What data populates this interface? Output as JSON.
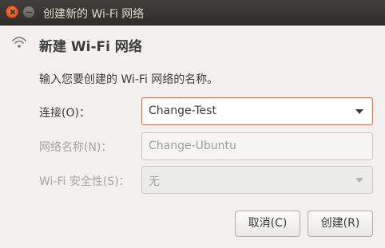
{
  "window": {
    "title": "创建新的 Wi-Fi 网络"
  },
  "header": {
    "icon": "wifi-icon",
    "title": "新建 Wi-Fi 网络"
  },
  "description": "输入您要创建的 Wi-Fi 网络的名称。",
  "form": {
    "connection": {
      "label": "连接(O)：",
      "value": "Change-Test"
    },
    "network_name": {
      "label": "网络名称(N)：",
      "value": "Change-Ubuntu"
    },
    "security": {
      "label": "Wi-Fi 安全性(S)：",
      "value": "无"
    }
  },
  "buttons": {
    "cancel": "取消(C)",
    "create": "创建(R)"
  },
  "colors": {
    "accent": "#e96d3f",
    "titlebar": "#3c3b37"
  }
}
